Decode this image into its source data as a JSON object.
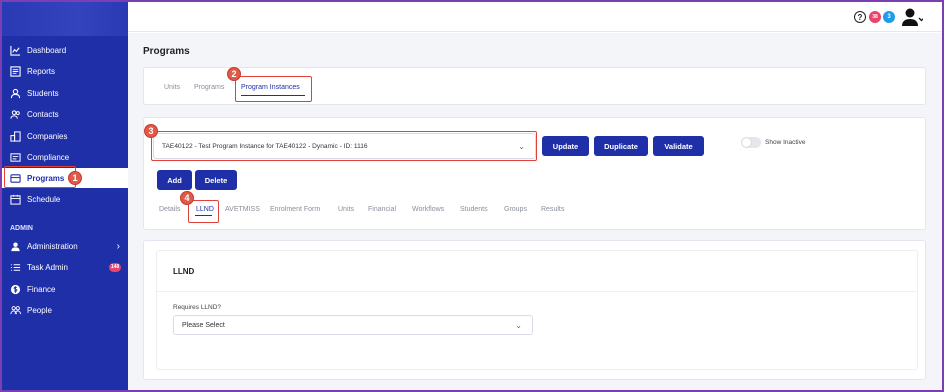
{
  "sidebar": {
    "items": [
      {
        "label": "Dashboard",
        "icon": "chart-line-icon"
      },
      {
        "label": "Reports",
        "icon": "report-icon"
      },
      {
        "label": "Students",
        "icon": "students-icon"
      },
      {
        "label": "Contacts",
        "icon": "contacts-icon"
      },
      {
        "label": "Companies",
        "icon": "companies-icon"
      },
      {
        "label": "Compliance",
        "icon": "compliance-icon"
      },
      {
        "label": "Programs",
        "icon": "programs-icon"
      },
      {
        "label": "Schedule",
        "icon": "schedule-icon"
      }
    ],
    "section_label": "ADMIN",
    "admin_items": [
      {
        "label": "Administration",
        "icon": "admin-icon"
      },
      {
        "label": "Task Admin",
        "icon": "task-list-icon",
        "badge": "148"
      },
      {
        "label": "Finance",
        "icon": "finance-icon"
      },
      {
        "label": "People",
        "icon": "people-icon"
      }
    ]
  },
  "topbar": {
    "notification_badge_1": "38",
    "notification_badge_2": "3"
  },
  "page": {
    "title": "Programs",
    "tabs": [
      "Units",
      "Programs",
      "Program Instances"
    ],
    "instance_select": "TAE40122 - Test Program Instance for TAE40122 - Dynamic - ID: 1116",
    "buttons": {
      "update": "Update",
      "duplicate": "Duplicate",
      "validate": "Validate",
      "add": "Add",
      "delete": "Delete"
    },
    "show_inactive_label": "Show Inactive",
    "sub_tabs": [
      "Details",
      "LLND",
      "AVETMISS",
      "Enrolment Form",
      "Units",
      "Financial",
      "Workflows",
      "Students",
      "Groups",
      "Results"
    ],
    "llnd": {
      "heading": "LLND",
      "field_label": "Requires LLND?",
      "field_value": "Please Select"
    }
  },
  "callouts": [
    "1",
    "2",
    "3",
    "4"
  ],
  "colors": {
    "sidebar": "#1f2fa8",
    "accent": "#1f2fa8",
    "callout": "#e0413a",
    "badge_red": "#e8456e",
    "badge_blue": "#1e9be9"
  }
}
